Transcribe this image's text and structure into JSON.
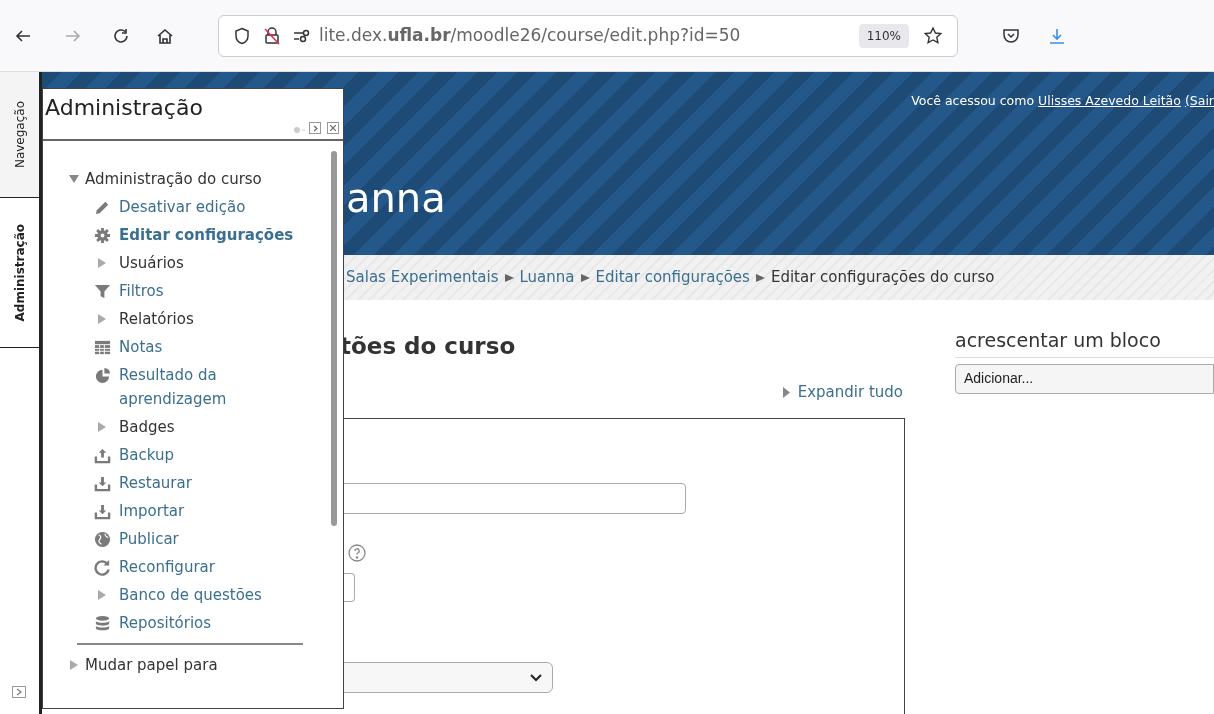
{
  "browser": {
    "url": "lite.dex.**ufla.br**/moodle26/course/edit.php?id=50",
    "zoom": "110%"
  },
  "dock": {
    "tabs": [
      {
        "label": "Navegação",
        "selected": false
      },
      {
        "label": "Administração",
        "selected": true
      }
    ]
  },
  "header": {
    "login_prefix": "Você acessou como",
    "user": "Ulisses Azevedo Leitão",
    "logout": "(Sair",
    "course_title": "anna"
  },
  "breadcrumb": [
    "Salas Experimentais",
    "Luanna",
    "Editar configurações",
    "Editar configurações do curso"
  ],
  "page": {
    "heading": "tões do curso",
    "expand_all": "Expandir tudo"
  },
  "block_adder": {
    "title": "acrescentar um bloco",
    "select": "Adicionar..."
  },
  "admin_block": {
    "title": "Administração",
    "items": [
      {
        "label": "Administração do curso",
        "expanded": true,
        "children": [
          {
            "label": "Desativar edição",
            "kind": "edit",
            "selected": false
          },
          {
            "label": "Editar configurações",
            "kind": "settings",
            "selected": true
          },
          {
            "label": "Usuários",
            "kind": "branch",
            "selected": false
          },
          {
            "label": "Filtros",
            "kind": "filter",
            "selected": false
          },
          {
            "label": "Relatórios",
            "kind": "branch",
            "selected": false
          },
          {
            "label": "Notas",
            "kind": "grades",
            "selected": false
          },
          {
            "label": "Resultado da aprendizagem",
            "kind": "outcomes",
            "selected": false
          },
          {
            "label": "Badges",
            "kind": "branch",
            "selected": false
          },
          {
            "label": "Backup",
            "kind": "backup",
            "selected": false
          },
          {
            "label": "Restaurar",
            "kind": "restore",
            "selected": false
          },
          {
            "label": "Importar",
            "kind": "import",
            "selected": false
          },
          {
            "label": "Publicar",
            "kind": "publish",
            "selected": false
          },
          {
            "label": "Reconfigurar",
            "kind": "reset",
            "selected": false
          },
          {
            "label": "Banco de questões",
            "kind": "linkbranch",
            "selected": false
          },
          {
            "label": "Repositórios",
            "kind": "repository",
            "selected": false
          }
        ]
      },
      {
        "label": "Mudar papel para",
        "expanded": false
      }
    ]
  }
}
